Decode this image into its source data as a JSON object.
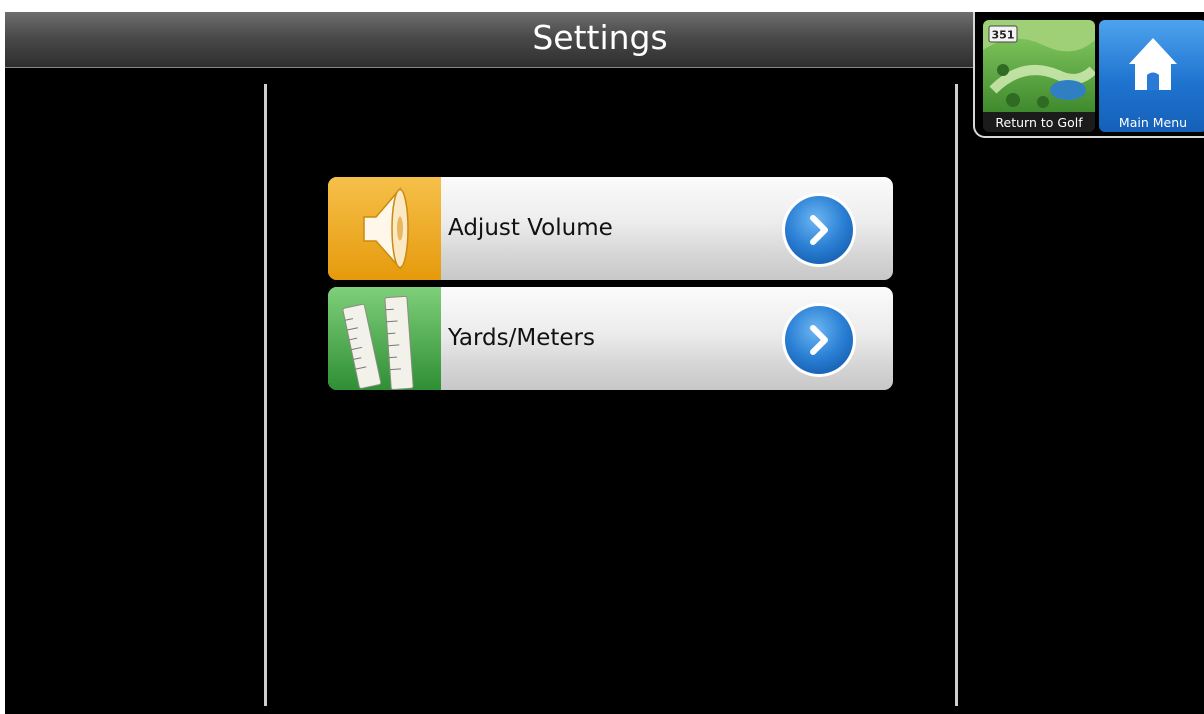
{
  "header": {
    "title": "Settings"
  },
  "nav": {
    "return_to_golf": {
      "label": "Return to Golf",
      "sign_number": "351",
      "icon": "golf-course-icon"
    },
    "main_menu": {
      "label": "Main Menu",
      "icon": "home-icon"
    }
  },
  "menu": {
    "items": [
      {
        "label": "Adjust Volume",
        "icon": "speaker-icon",
        "arrow_icon": "chevron-right-icon",
        "thumb_color": "#f0a81c"
      },
      {
        "label": "Yards/Meters",
        "icon": "ruler-icon",
        "arrow_icon": "chevron-right-icon",
        "thumb_color": "#43a447"
      }
    ]
  },
  "colors": {
    "background": "#000000",
    "accent_blue": "#1f74d0",
    "item_surface": "#e8e8e8"
  }
}
